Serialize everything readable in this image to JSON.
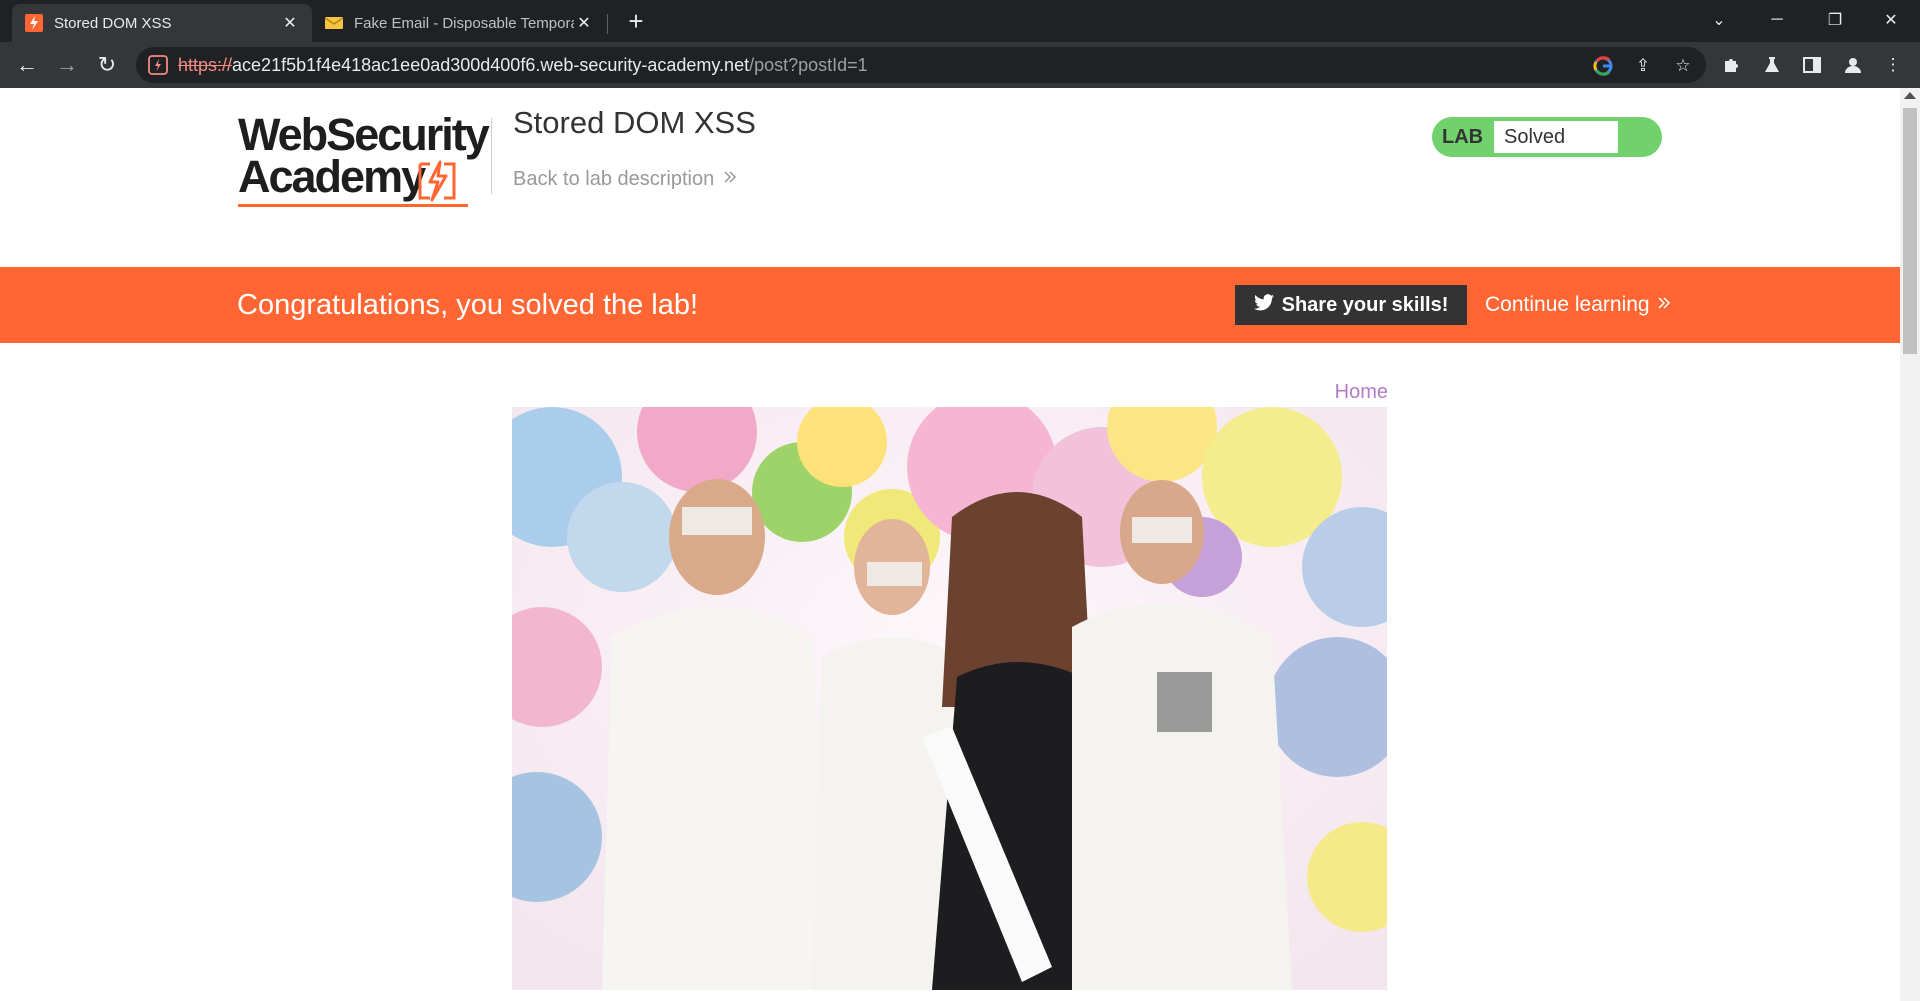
{
  "browser": {
    "tabs": [
      {
        "title": "Stored DOM XSS",
        "active": true,
        "icon": "portswigger-icon"
      },
      {
        "title": "Fake Email - Disposable Tempora",
        "active": false,
        "icon": "envelope-icon"
      }
    ],
    "url": {
      "scheme": "https://",
      "host": "ace21f5b1f4e418ac1ee0ad300d400f6.web-security-academy.net",
      "path": "/post?postId=1"
    }
  },
  "header": {
    "logo_line1": "WebSecurity",
    "logo_line2": "Academy",
    "lab_title": "Stored DOM XSS",
    "back_link": "Back to lab description",
    "status_label": "LAB",
    "status_value": "Solved"
  },
  "banner": {
    "message": "Congratulations, you solved the lab!",
    "share_label": "Share your skills!",
    "continue_label": "Continue learning"
  },
  "nav": {
    "home_label": "Home"
  },
  "colors": {
    "accent": "#ff6633",
    "solved": "#70d16d",
    "link_purple": "#b07cc6"
  }
}
